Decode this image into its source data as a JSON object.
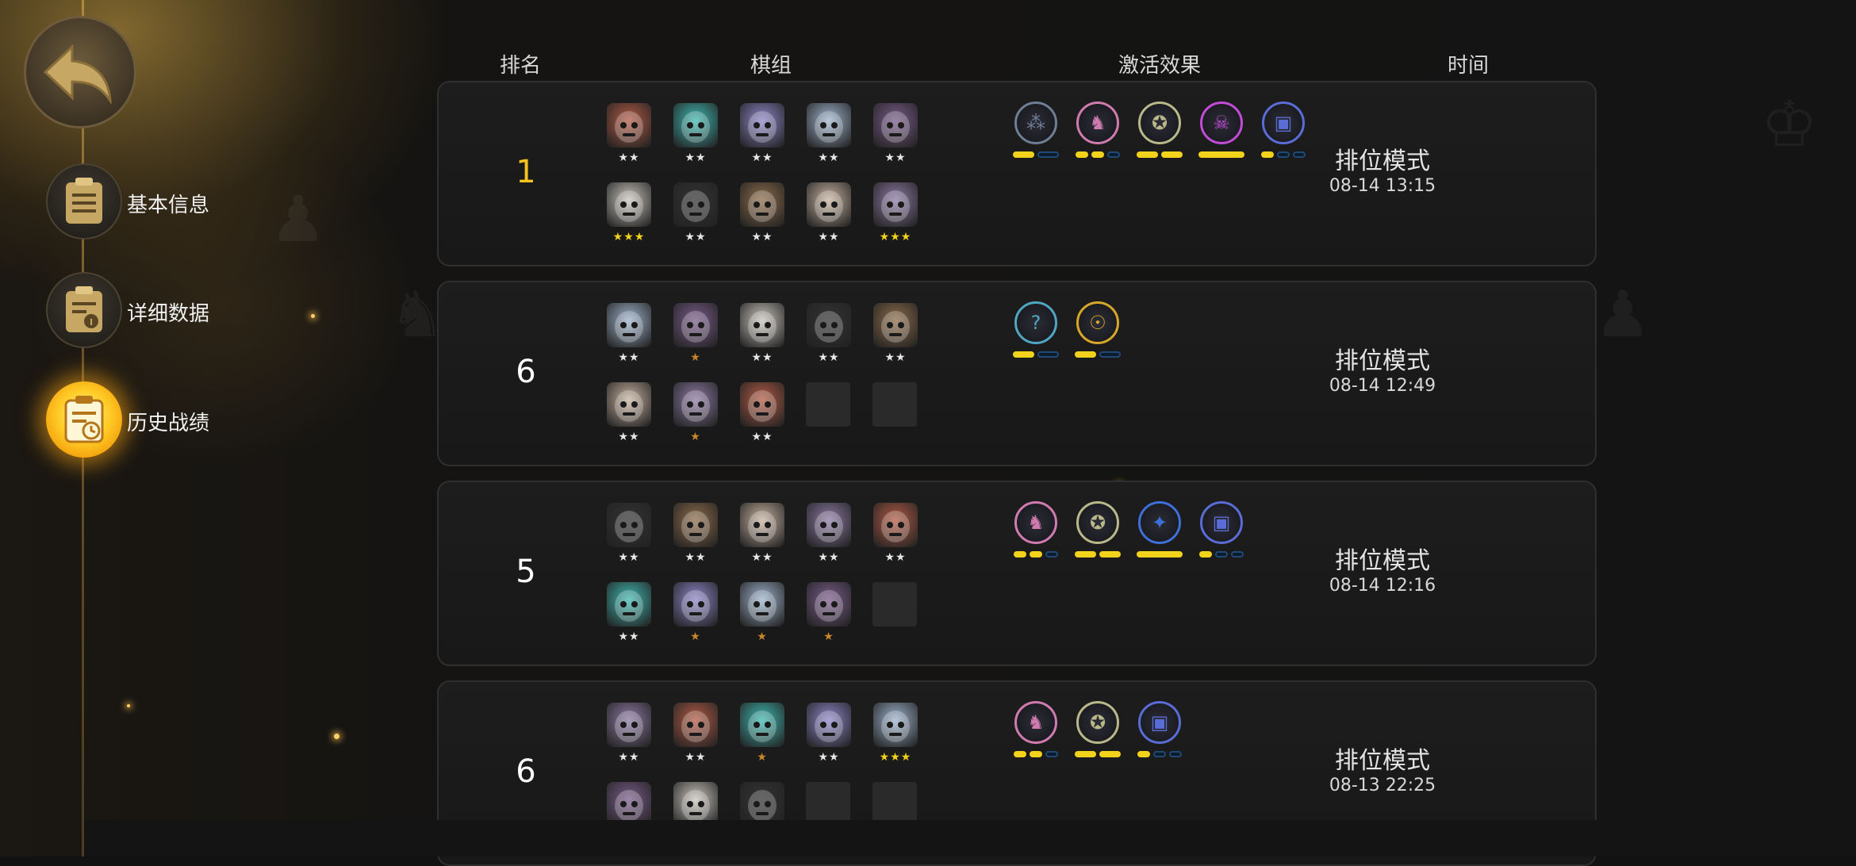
{
  "sidebar": {
    "items": [
      {
        "label": "基本信息",
        "icon": "clipboard-icon",
        "active": false
      },
      {
        "label": "详细数据",
        "icon": "data-clipboard-icon",
        "active": false
      },
      {
        "label": "历史战绩",
        "icon": "history-clipboard-icon",
        "active": true
      }
    ]
  },
  "headers": {
    "rank": "排名",
    "lineup": "棋组",
    "effects": "激活效果",
    "time": "时间"
  },
  "colors": {
    "accent": "#f6c21c",
    "bar_on": "#f2d21a",
    "bar_off": "#1f4a78"
  },
  "matches": [
    {
      "rank": "1",
      "mode": "排位模式",
      "time": "08-14 13:15",
      "pieces": [
        {
          "stars": "★★",
          "tier": "silver"
        },
        {
          "stars": "★★",
          "tier": "silver"
        },
        {
          "stars": "★★",
          "tier": "silver"
        },
        {
          "stars": "★★",
          "tier": "silver"
        },
        {
          "stars": "★★",
          "tier": "silver"
        },
        {
          "stars": "★★★",
          "tier": "gold"
        },
        {
          "stars": "★★",
          "tier": "silver"
        },
        {
          "stars": "★★",
          "tier": "silver"
        },
        {
          "stars": "★★",
          "tier": "silver"
        },
        {
          "stars": "★★★",
          "tier": "gold"
        }
      ],
      "synergies": [
        {
          "icon": "clan-icon",
          "color": "#6d7e95",
          "bars": [
            1,
            0
          ]
        },
        {
          "icon": "knight-icon",
          "color": "#d07bb0",
          "bars": [
            1,
            1,
            0
          ]
        },
        {
          "icon": "beast-icon",
          "color": "#b9b88a",
          "bars": [
            1,
            1
          ]
        },
        {
          "icon": "demon-icon",
          "color": "#c24bd8",
          "bars": [
            1
          ]
        },
        {
          "icon": "warlock-icon",
          "color": "#5a6cd6",
          "bars": [
            1,
            0,
            0
          ]
        }
      ]
    },
    {
      "rank": "6",
      "mode": "排位模式",
      "time": "08-14 12:49",
      "pieces": [
        {
          "stars": "★★",
          "tier": "silver"
        },
        {
          "stars": "★",
          "tier": "bronze"
        },
        {
          "stars": "★★",
          "tier": "silver"
        },
        {
          "stars": "★★",
          "tier": "silver"
        },
        {
          "stars": "★★",
          "tier": "silver"
        },
        {
          "stars": "★★",
          "tier": "silver"
        },
        {
          "stars": "★",
          "tier": "bronze"
        },
        {
          "stars": "★★",
          "tier": "silver"
        },
        {
          "stars": "",
          "tier": "empty"
        },
        {
          "stars": "",
          "tier": "empty"
        }
      ],
      "synergies": [
        {
          "icon": "mystery-icon",
          "color": "#4fa6c2",
          "bars": [
            1,
            0
          ]
        },
        {
          "icon": "hero-icon",
          "color": "#d6a728",
          "bars": [
            1,
            0
          ]
        }
      ]
    },
    {
      "rank": "5",
      "mode": "排位模式",
      "time": "08-14 12:16",
      "pieces": [
        {
          "stars": "★★",
          "tier": "silver"
        },
        {
          "stars": "★★",
          "tier": "silver"
        },
        {
          "stars": "★★",
          "tier": "silver"
        },
        {
          "stars": "★★",
          "tier": "silver"
        },
        {
          "stars": "★★",
          "tier": "silver"
        },
        {
          "stars": "★★",
          "tier": "silver"
        },
        {
          "stars": "★",
          "tier": "bronze"
        },
        {
          "stars": "★",
          "tier": "bronze"
        },
        {
          "stars": "★",
          "tier": "bronze"
        },
        {
          "stars": "",
          "tier": "empty"
        }
      ],
      "synergies": [
        {
          "icon": "knight-icon",
          "color": "#d07bb0",
          "bars": [
            1,
            1,
            0
          ]
        },
        {
          "icon": "beast-icon",
          "color": "#b9b88a",
          "bars": [
            1,
            1
          ]
        },
        {
          "icon": "dragon-icon",
          "color": "#3f6fd8",
          "bars": [
            1
          ]
        },
        {
          "icon": "warlock-icon",
          "color": "#5a6cd6",
          "bars": [
            1,
            0,
            0
          ]
        }
      ]
    },
    {
      "rank": "6",
      "mode": "排位模式",
      "time": "08-13 22:25",
      "pieces": [
        {
          "stars": "★★",
          "tier": "silver"
        },
        {
          "stars": "★★",
          "tier": "silver"
        },
        {
          "stars": "★",
          "tier": "bronze"
        },
        {
          "stars": "★★",
          "tier": "silver"
        },
        {
          "stars": "★★★",
          "tier": "gold"
        },
        {
          "stars": "",
          "tier": "silver"
        },
        {
          "stars": "",
          "tier": "silver"
        },
        {
          "stars": "",
          "tier": "silver"
        },
        {
          "stars": "",
          "tier": "empty"
        },
        {
          "stars": "",
          "tier": "empty"
        }
      ],
      "synergies": [
        {
          "icon": "knight-icon",
          "color": "#d07bb0",
          "bars": [
            1,
            1,
            0
          ]
        },
        {
          "icon": "beast-icon",
          "color": "#b9b88a",
          "bars": [
            1,
            1
          ]
        },
        {
          "icon": "warlock-icon",
          "color": "#5a6cd6",
          "bars": [
            1,
            0,
            0
          ]
        }
      ]
    }
  ]
}
